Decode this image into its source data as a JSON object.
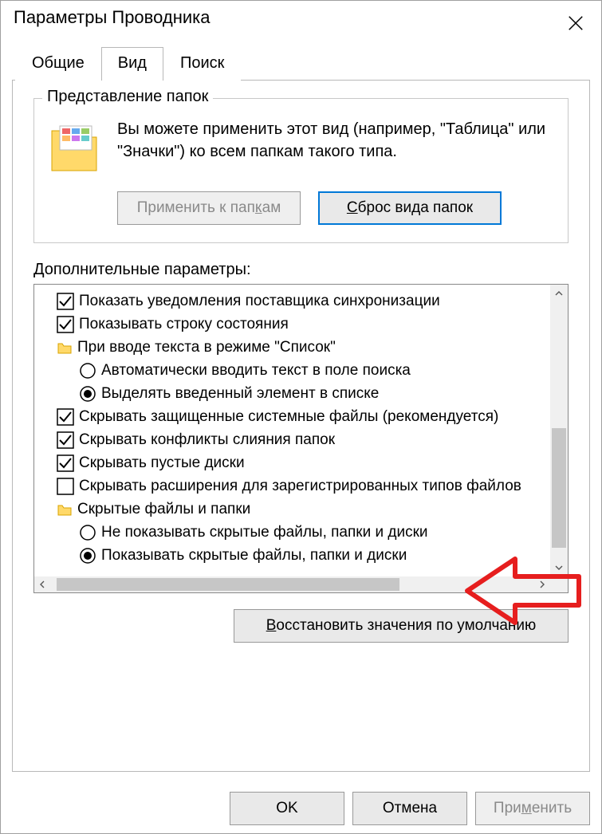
{
  "window": {
    "title": "Параметры Проводника"
  },
  "tabs": {
    "general": "Общие",
    "view": "Вид",
    "search": "Поиск"
  },
  "folderViews": {
    "legend": "Представление папок",
    "desc": "Вы можете применить этот вид (например, \"Таблица\" или \"Значки\") ко всем папкам такого типа.",
    "apply": "Применить к папкам",
    "reset": "Сброс вида папок"
  },
  "advanced": {
    "label": "Дополнительные параметры:",
    "items": [
      {
        "label": "Показать уведомления поставщика синхронизации"
      },
      {
        "label": "Показывать строку состояния"
      },
      {
        "label": "При вводе текста в режиме \"Список\""
      },
      {
        "label": "Автоматически вводить текст в поле поиска"
      },
      {
        "label": "Выделять введенный элемент в списке"
      },
      {
        "label": "Скрывать защищенные системные файлы (рекомендуется)"
      },
      {
        "label": "Скрывать конфликты слияния папок"
      },
      {
        "label": "Скрывать пустые диски"
      },
      {
        "label": "Скрывать расширения для зарегистрированных типов файлов"
      },
      {
        "label": "Скрытые файлы и папки"
      },
      {
        "label": "Не показывать скрытые файлы, папки и диски"
      },
      {
        "label": "Показывать скрытые файлы, папки и диски"
      }
    ],
    "restore": "Восстановить значения по умолчанию"
  },
  "footer": {
    "ok": "OK",
    "cancel": "Отмена",
    "apply": "Применить"
  }
}
